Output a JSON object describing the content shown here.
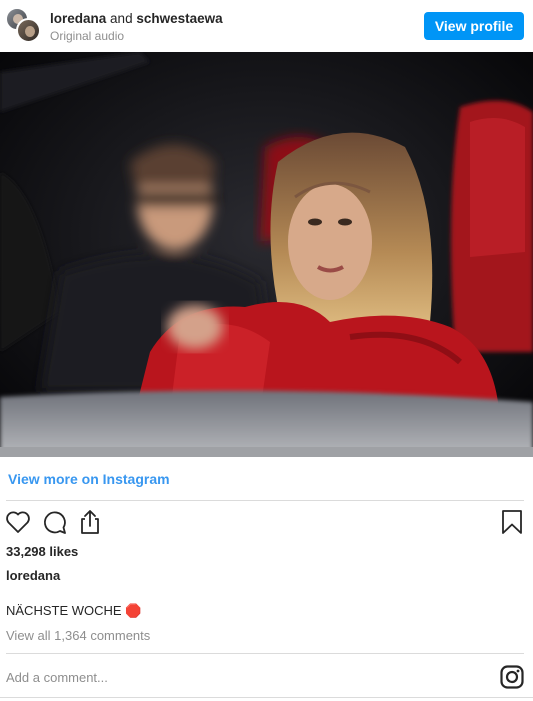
{
  "header": {
    "user1": "loredana",
    "and_word": "and",
    "user2": "schwestaewa",
    "audio": "Original audio",
    "view_profile_label": "View profile"
  },
  "media": {
    "description_icon": "video-post"
  },
  "links": {
    "view_more": "View more on Instagram"
  },
  "actions": {
    "icons": [
      "heart-icon",
      "comment-icon",
      "share-icon",
      "bookmark-icon"
    ]
  },
  "post": {
    "likes": "33,298 likes",
    "owner": "loredana",
    "caption": "NÄCHSTE WOCHE 🛑",
    "view_comments": "View all 1,364 comments"
  },
  "comment": {
    "placeholder": "Add a comment..."
  },
  "colors": {
    "accent": "#0095f6",
    "link": "#3897f0",
    "muted": "#8e8e8e",
    "text": "#262626"
  }
}
